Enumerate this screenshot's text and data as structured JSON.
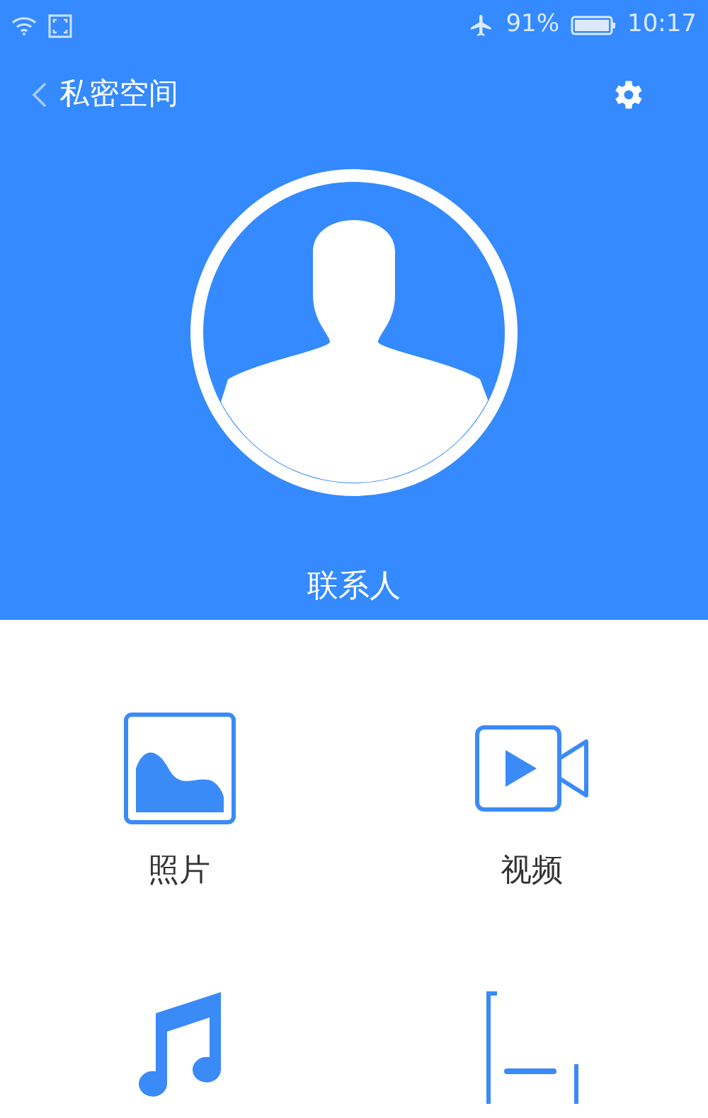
{
  "status_bar": {
    "battery": "91%",
    "time": "10:17"
  },
  "header": {
    "title": "私密空间"
  },
  "profile": {
    "label": "联系人"
  },
  "items": [
    {
      "kind": "photo",
      "label": "照片"
    },
    {
      "kind": "video",
      "label": "视频"
    },
    {
      "kind": "music"
    },
    {
      "kind": "document"
    }
  ]
}
